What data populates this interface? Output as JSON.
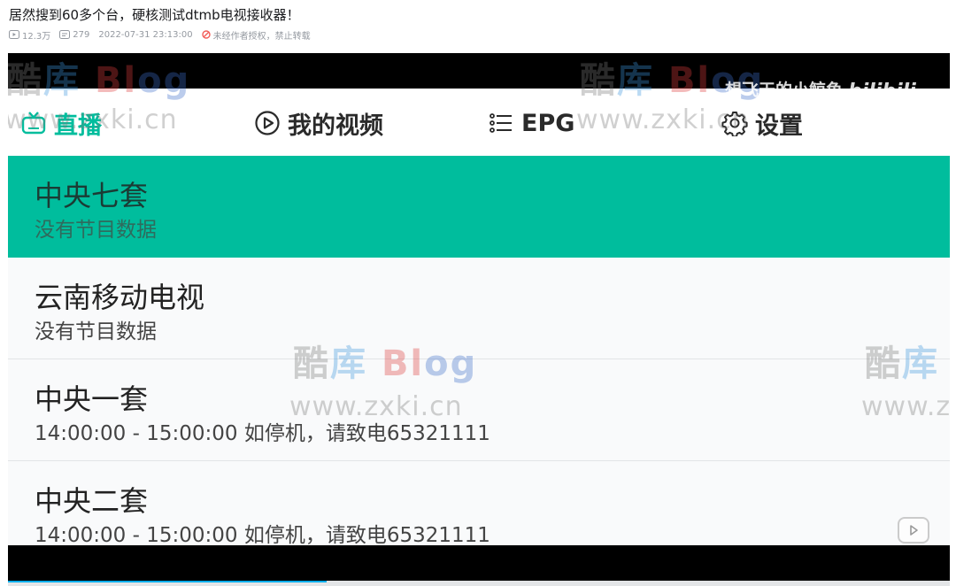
{
  "page": {
    "title": "居然搜到60多个台，硬核测试dtmb电视接收器！",
    "meta": {
      "views": "12.3万",
      "danmaku": "279",
      "datetime": "2022-07-31 23:13:00",
      "copyright_notice": "未经作者授权，禁止转载"
    }
  },
  "player": {
    "uploader_watermark": "想飞天的小鲸鱼",
    "brand_logo": "bilibili"
  },
  "watermark": {
    "logo_chars": [
      "酷",
      "库",
      "Bl",
      "og"
    ],
    "url": "www.zxki.cn"
  },
  "app": {
    "nav": {
      "tabs": [
        {
          "label": "直播",
          "icon": "tv-icon",
          "active": true
        },
        {
          "label": "我的视频",
          "icon": "play-circle-icon",
          "active": false
        },
        {
          "label": "EPG",
          "icon": "list-icon",
          "active": false
        },
        {
          "label": "设置",
          "icon": "gear-icon",
          "active": false
        }
      ]
    },
    "channels": [
      {
        "name": "中央七套",
        "program": "没有节目数据",
        "selected": true
      },
      {
        "name": "云南移动电视",
        "program": "没有节目数据",
        "selected": false
      },
      {
        "name": "中央一套",
        "program": "14:00:00 - 15:00:00  如停机，请致电65321111",
        "selected": false
      },
      {
        "name": "中央二套",
        "program": "14:00:00 - 15:00:00  如停机，请致电65321111",
        "selected": false
      }
    ]
  },
  "colors": {
    "accent": "#00bd9d",
    "selected_row": "#00bd9d",
    "progress": "#00aeec"
  }
}
